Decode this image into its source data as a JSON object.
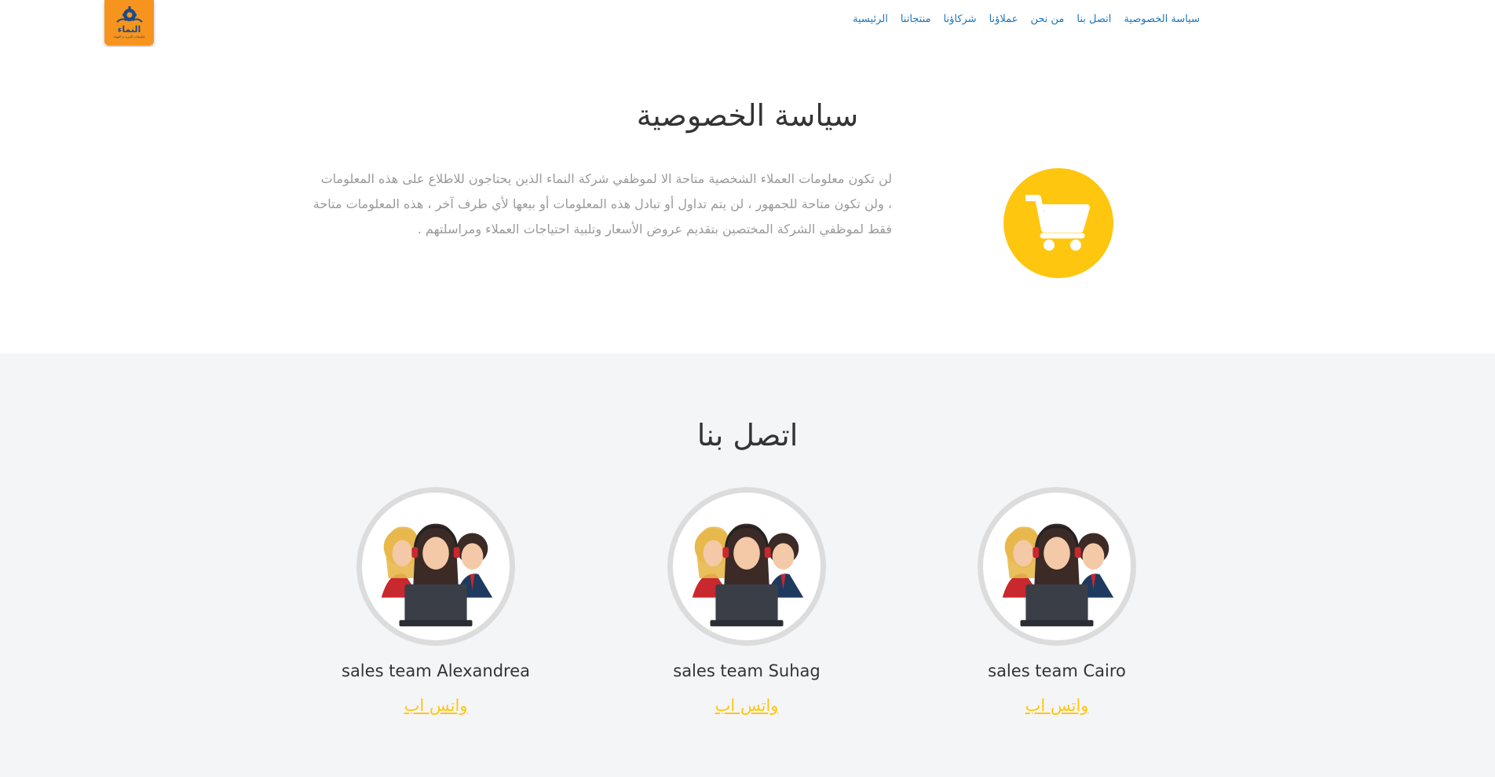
{
  "brand": {
    "logo_text": "النماء",
    "logo_subtext": "لتكييفات التبريد و التهيئة",
    "accent_color": "#f7941d",
    "link_color": "#1b75bc",
    "highlight_color": "#ffc610"
  },
  "nav": {
    "items": [
      {
        "label": "الرئيسية"
      },
      {
        "label": "منتجاتنا"
      },
      {
        "label": "شركاؤنا"
      },
      {
        "label": "عملاؤنا"
      },
      {
        "label": "من نحن"
      },
      {
        "label": "اتصل بنا"
      },
      {
        "label": "سياسة الخصوصية"
      }
    ]
  },
  "privacy": {
    "title": "سياسة الخصوصية",
    "lines": [
      "لن تكون معلومات العملاء الشخصية متاحة الا لموظفي شركة النماء الذين يحتاجون للاطلاع على هذه المعلومات",
      "، ولن تكون متاحة للجمهور ، لن يتم تداول أو تبادل هذه المعلومات أو بيعها لأي طرف آخر ، هذه المعلومات متاحة",
      "فقط لموظفي الشركة المختصين بتقديم عروض الأسعار وتلبية احتياجات العملاء ومراسلتهم ."
    ],
    "icon": "shopping-cart-icon"
  },
  "contact": {
    "title": "اتصل بنا",
    "teams": [
      {
        "name": "sales team Cairo",
        "link": "واتس اب"
      },
      {
        "name": "sales team Suhag",
        "link": "واتس اب"
      },
      {
        "name": "sales team Alexandrea",
        "link": "واتس اب"
      }
    ],
    "photo_icon": "customer-support-team-icon"
  }
}
